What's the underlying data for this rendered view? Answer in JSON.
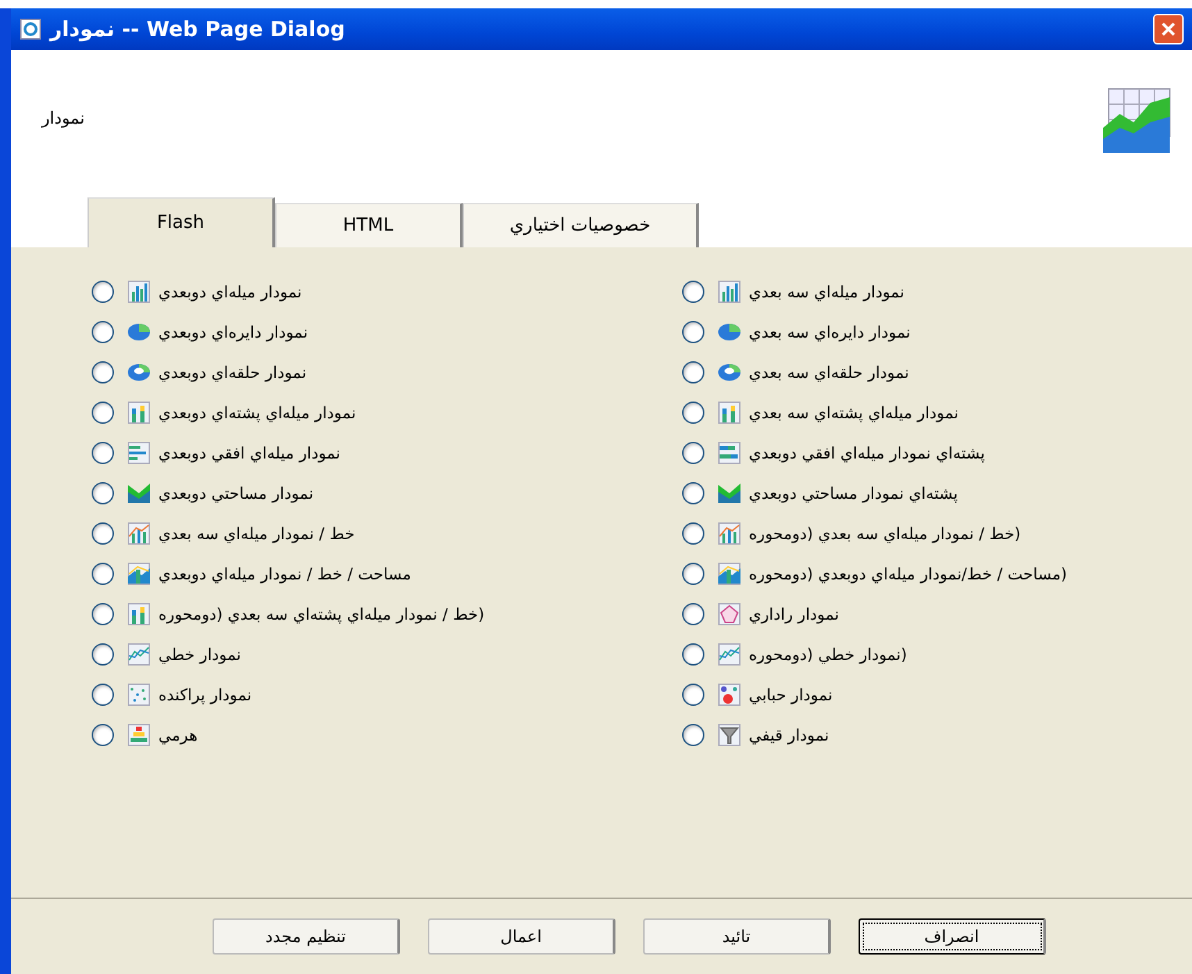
{
  "window": {
    "title": "Web Page Dialog -- نمودار"
  },
  "header": {
    "label": "نمودار"
  },
  "tabs": [
    {
      "label": "خصوصيات اختياري",
      "selected": false
    },
    {
      "label": "HTML",
      "selected": false
    },
    {
      "label": "Flash",
      "selected": true
    }
  ],
  "chart_types": [
    [
      {
        "label": "نمودار ميله‌اي سه بعدي",
        "kind": "bar",
        "selected": false
      },
      {
        "label": "نمودار دايره‌اي سه بعدي",
        "kind": "pie",
        "selected": false
      },
      {
        "label": "نمودار حلقه‌اي سه بعدي",
        "kind": "donut",
        "selected": false
      },
      {
        "label": "نمودار ميله‌اي پشته‌اي سه بعدي",
        "kind": "stacked",
        "selected": false
      },
      {
        "label": "پشته‌اي نمودار ميله‌اي افقي دوبعدي",
        "kind": "hstacked",
        "selected": false
      },
      {
        "label": "پشته‌اي نمودار مساحتي دوبعدي",
        "kind": "area",
        "selected": false
      },
      {
        "label": "(خط / نمودار ميله‌اي سه بعدي (دومحوره",
        "kind": "combo",
        "selected": false
      },
      {
        "label": "(مساحت / خط/نمودار ميله‌اي دوبعدي (دومحوره",
        "kind": "areacombo",
        "selected": false
      },
      {
        "label": "نمودار راداري",
        "kind": "radar",
        "selected": false
      },
      {
        "label": "(نمودار خطي (دومحوره",
        "kind": "line",
        "selected": false
      },
      {
        "label": "نمودار حبابي",
        "kind": "bubble",
        "selected": false
      },
      {
        "label": "نمودار قيفي",
        "kind": "funnel",
        "selected": false
      }
    ],
    [
      {
        "label": "نمودار ميله‌اي دوبعدي",
        "kind": "bar",
        "selected": false
      },
      {
        "label": "نمودار دايره‌اي دوبعدي",
        "kind": "pie",
        "selected": false
      },
      {
        "label": "نمودار حلقه‌اي دوبعدي",
        "kind": "donut",
        "selected": false
      },
      {
        "label": "نمودار ميله‌اي پشته‌اي دوبعدي",
        "kind": "stacked",
        "selected": false
      },
      {
        "label": "نمودار ميله‌اي افقي دوبعدي",
        "kind": "hbar",
        "selected": false
      },
      {
        "label": "نمودار مساحتي دوبعدي",
        "kind": "area",
        "selected": false
      },
      {
        "label": "خط / نمودار ميله‌اي سه بعدي",
        "kind": "combo",
        "selected": false
      },
      {
        "label": "مساحت / خط / نمودار ميله‌اي دوبعدي",
        "kind": "areacombo",
        "selected": false
      },
      {
        "label": "(خط / نمودار ميله‌اي پشته‌اي سه بعدي (دومحوره",
        "kind": "stacked",
        "selected": false
      },
      {
        "label": "نمودار خطي",
        "kind": "line",
        "selected": false
      },
      {
        "label": "نمودار پراكنده",
        "kind": "scatter",
        "selected": false
      },
      {
        "label": "هرمي",
        "kind": "pyramid",
        "selected": false
      }
    ]
  ],
  "buttons": [
    {
      "label": "انصراف",
      "focused": true
    },
    {
      "label": "تائيد",
      "focused": false
    },
    {
      "label": "اعمال",
      "focused": false
    },
    {
      "label": "تنظيم مجدد",
      "focused": false
    }
  ]
}
